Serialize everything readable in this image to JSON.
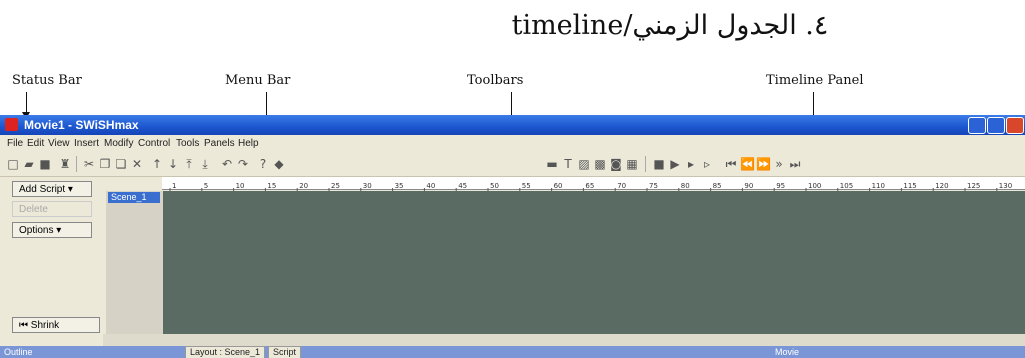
{
  "heading": "٤. الجدول الزمني/timeline",
  "callouts": {
    "status_bar": "Status Bar",
    "menu_bar": "Menu Bar",
    "toolbars": "Toolbars",
    "timeline_panel": "Timeline Panel"
  },
  "window": {
    "title": "Movie1 - SWiSHmax",
    "menu": [
      "File",
      "Edit",
      "View",
      "Insert",
      "Modify",
      "Control",
      "Tools",
      "Panels",
      "Help"
    ]
  },
  "timeline": {
    "add_script": "Add Script",
    "delete": "Delete",
    "options": "Options",
    "shrink": "Shrink",
    "scene": "Scene_1",
    "ruler_ticks": [
      "1",
      "5",
      "10",
      "15",
      "20",
      "25",
      "30",
      "35",
      "40",
      "45",
      "50",
      "55",
      "60",
      "65",
      "70",
      "75",
      "80",
      "85",
      "90",
      "95",
      "100",
      "105",
      "110",
      "115",
      "120",
      "125",
      "130"
    ]
  },
  "bottom": {
    "outline": "Outline",
    "layout_tab": "Layout : Scene_1",
    "script_tab": "Script",
    "movie": "Movie"
  },
  "colors": {
    "titlebar": "#1c56cf",
    "panel_bg": "#5a6b64",
    "scene_highlight": "#3a6fd0"
  }
}
